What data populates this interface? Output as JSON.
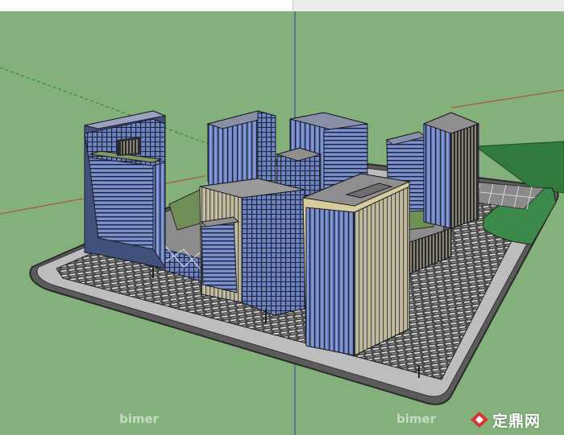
{
  "watermarks": {
    "left": "bimer",
    "right": "bimer"
  },
  "brand": {
    "name": "定鼎网"
  },
  "colors": {
    "sky_ground": "#84b07c",
    "axis_green": "#1c8a33",
    "axis_red": "#b9423c",
    "axis_blue": "#2a3fa8",
    "glass": "#6e86c9",
    "frame": "#2a2a33",
    "slab": "#8f8f8f",
    "road": "#bdbdbd",
    "pavement": "#4a4a4a",
    "park": "#3c8a4a",
    "tower_tan": "#d8cc9a"
  }
}
